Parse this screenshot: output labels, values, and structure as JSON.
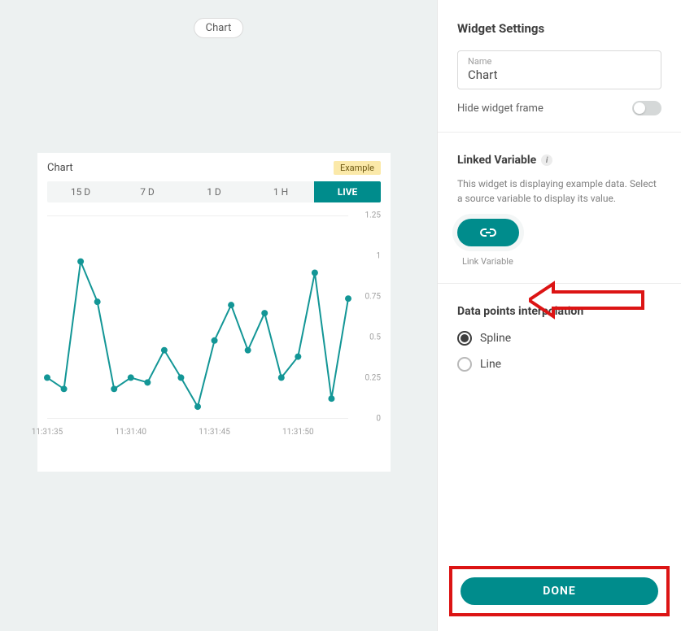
{
  "chart_pill": "Chart",
  "card": {
    "title": "Chart",
    "badge": "Example",
    "ranges": [
      "15 D",
      "7 D",
      "1 D",
      "1 H",
      "LIVE"
    ],
    "activeRange": 4
  },
  "chart_data": {
    "type": "line",
    "x_ticks": [
      "11:31:35",
      "11:31:40",
      "11:31:45",
      "11:31:50"
    ],
    "y_ticks": [
      "0",
      "0.25",
      "0.5",
      "0.75",
      "1",
      "1.25"
    ],
    "ylim": [
      0,
      1.25
    ],
    "values": [
      0.25,
      0.18,
      0.97,
      0.72,
      0.18,
      0.25,
      0.22,
      0.42,
      0.25,
      0.07,
      0.48,
      0.7,
      0.42,
      0.65,
      0.25,
      0.38,
      0.9,
      0.12,
      0.74
    ]
  },
  "settings": {
    "heading": "Widget Settings",
    "name_label": "Name",
    "name_value": "Chart",
    "hide_frame": "Hide widget frame"
  },
  "linked": {
    "heading": "Linked Variable",
    "hint": "This widget is displaying example data. Select a source variable to display its value.",
    "caption": "Link Variable"
  },
  "interp": {
    "heading": "Data points interpolation",
    "options": [
      "Spline",
      "Line"
    ],
    "selected": 0
  },
  "done": "DONE"
}
